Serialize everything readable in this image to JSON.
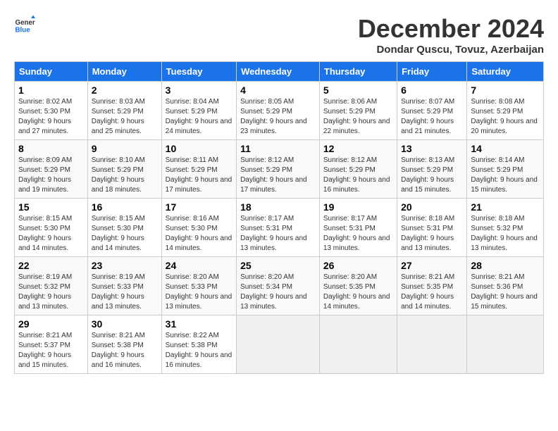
{
  "logo": {
    "line1": "General",
    "line2": "Blue"
  },
  "title": "December 2024",
  "subtitle": "Dondar Quscu, Tovuz, Azerbaijan",
  "days_of_week": [
    "Sunday",
    "Monday",
    "Tuesday",
    "Wednesday",
    "Thursday",
    "Friday",
    "Saturday"
  ],
  "weeks": [
    [
      {
        "day": "1",
        "sunrise": "Sunrise: 8:02 AM",
        "sunset": "Sunset: 5:30 PM",
        "daylight": "Daylight: 9 hours and 27 minutes."
      },
      {
        "day": "2",
        "sunrise": "Sunrise: 8:03 AM",
        "sunset": "Sunset: 5:29 PM",
        "daylight": "Daylight: 9 hours and 25 minutes."
      },
      {
        "day": "3",
        "sunrise": "Sunrise: 8:04 AM",
        "sunset": "Sunset: 5:29 PM",
        "daylight": "Daylight: 9 hours and 24 minutes."
      },
      {
        "day": "4",
        "sunrise": "Sunrise: 8:05 AM",
        "sunset": "Sunset: 5:29 PM",
        "daylight": "Daylight: 9 hours and 23 minutes."
      },
      {
        "day": "5",
        "sunrise": "Sunrise: 8:06 AM",
        "sunset": "Sunset: 5:29 PM",
        "daylight": "Daylight: 9 hours and 22 minutes."
      },
      {
        "day": "6",
        "sunrise": "Sunrise: 8:07 AM",
        "sunset": "Sunset: 5:29 PM",
        "daylight": "Daylight: 9 hours and 21 minutes."
      },
      {
        "day": "7",
        "sunrise": "Sunrise: 8:08 AM",
        "sunset": "Sunset: 5:29 PM",
        "daylight": "Daylight: 9 hours and 20 minutes."
      }
    ],
    [
      {
        "day": "8",
        "sunrise": "Sunrise: 8:09 AM",
        "sunset": "Sunset: 5:29 PM",
        "daylight": "Daylight: 9 hours and 19 minutes."
      },
      {
        "day": "9",
        "sunrise": "Sunrise: 8:10 AM",
        "sunset": "Sunset: 5:29 PM",
        "daylight": "Daylight: 9 hours and 18 minutes."
      },
      {
        "day": "10",
        "sunrise": "Sunrise: 8:11 AM",
        "sunset": "Sunset: 5:29 PM",
        "daylight": "Daylight: 9 hours and 17 minutes."
      },
      {
        "day": "11",
        "sunrise": "Sunrise: 8:12 AM",
        "sunset": "Sunset: 5:29 PM",
        "daylight": "Daylight: 9 hours and 17 minutes."
      },
      {
        "day": "12",
        "sunrise": "Sunrise: 8:12 AM",
        "sunset": "Sunset: 5:29 PM",
        "daylight": "Daylight: 9 hours and 16 minutes."
      },
      {
        "day": "13",
        "sunrise": "Sunrise: 8:13 AM",
        "sunset": "Sunset: 5:29 PM",
        "daylight": "Daylight: 9 hours and 15 minutes."
      },
      {
        "day": "14",
        "sunrise": "Sunrise: 8:14 AM",
        "sunset": "Sunset: 5:29 PM",
        "daylight": "Daylight: 9 hours and 15 minutes."
      }
    ],
    [
      {
        "day": "15",
        "sunrise": "Sunrise: 8:15 AM",
        "sunset": "Sunset: 5:30 PM",
        "daylight": "Daylight: 9 hours and 14 minutes."
      },
      {
        "day": "16",
        "sunrise": "Sunrise: 8:15 AM",
        "sunset": "Sunset: 5:30 PM",
        "daylight": "Daylight: 9 hours and 14 minutes."
      },
      {
        "day": "17",
        "sunrise": "Sunrise: 8:16 AM",
        "sunset": "Sunset: 5:30 PM",
        "daylight": "Daylight: 9 hours and 14 minutes."
      },
      {
        "day": "18",
        "sunrise": "Sunrise: 8:17 AM",
        "sunset": "Sunset: 5:31 PM",
        "daylight": "Daylight: 9 hours and 13 minutes."
      },
      {
        "day": "19",
        "sunrise": "Sunrise: 8:17 AM",
        "sunset": "Sunset: 5:31 PM",
        "daylight": "Daylight: 9 hours and 13 minutes."
      },
      {
        "day": "20",
        "sunrise": "Sunrise: 8:18 AM",
        "sunset": "Sunset: 5:31 PM",
        "daylight": "Daylight: 9 hours and 13 minutes."
      },
      {
        "day": "21",
        "sunrise": "Sunrise: 8:18 AM",
        "sunset": "Sunset: 5:32 PM",
        "daylight": "Daylight: 9 hours and 13 minutes."
      }
    ],
    [
      {
        "day": "22",
        "sunrise": "Sunrise: 8:19 AM",
        "sunset": "Sunset: 5:32 PM",
        "daylight": "Daylight: 9 hours and 13 minutes."
      },
      {
        "day": "23",
        "sunrise": "Sunrise: 8:19 AM",
        "sunset": "Sunset: 5:33 PM",
        "daylight": "Daylight: 9 hours and 13 minutes."
      },
      {
        "day": "24",
        "sunrise": "Sunrise: 8:20 AM",
        "sunset": "Sunset: 5:33 PM",
        "daylight": "Daylight: 9 hours and 13 minutes."
      },
      {
        "day": "25",
        "sunrise": "Sunrise: 8:20 AM",
        "sunset": "Sunset: 5:34 PM",
        "daylight": "Daylight: 9 hours and 13 minutes."
      },
      {
        "day": "26",
        "sunrise": "Sunrise: 8:20 AM",
        "sunset": "Sunset: 5:35 PM",
        "daylight": "Daylight: 9 hours and 14 minutes."
      },
      {
        "day": "27",
        "sunrise": "Sunrise: 8:21 AM",
        "sunset": "Sunset: 5:35 PM",
        "daylight": "Daylight: 9 hours and 14 minutes."
      },
      {
        "day": "28",
        "sunrise": "Sunrise: 8:21 AM",
        "sunset": "Sunset: 5:36 PM",
        "daylight": "Daylight: 9 hours and 15 minutes."
      }
    ],
    [
      {
        "day": "29",
        "sunrise": "Sunrise: 8:21 AM",
        "sunset": "Sunset: 5:37 PM",
        "daylight": "Daylight: 9 hours and 15 minutes."
      },
      {
        "day": "30",
        "sunrise": "Sunrise: 8:21 AM",
        "sunset": "Sunset: 5:38 PM",
        "daylight": "Daylight: 9 hours and 16 minutes."
      },
      {
        "day": "31",
        "sunrise": "Sunrise: 8:22 AM",
        "sunset": "Sunset: 5:38 PM",
        "daylight": "Daylight: 9 hours and 16 minutes."
      },
      null,
      null,
      null,
      null
    ]
  ]
}
